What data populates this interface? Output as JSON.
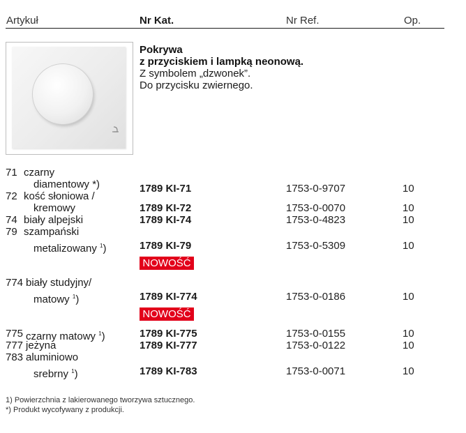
{
  "header": {
    "artykul": "Artykuł",
    "nr_kat": "Nr Kat.",
    "nr_ref": "Nr Ref.",
    "op": "Op."
  },
  "product": {
    "title_line1": "Pokrywa",
    "title_line2": "z przyciskiem i lampką neonową.",
    "desc_line1": "Z symbolem „dzwonek”.",
    "desc_line2": "Do przycisku zwiernego.",
    "image_icon": "bell-symbol-icon"
  },
  "rows": [
    {
      "num": "71",
      "name1": "czarny",
      "name2": "diamentowy *)",
      "sup": "",
      "kat": "1789 KI-71",
      "ref": "1753-0-9707",
      "op": "10"
    },
    {
      "num": "72",
      "name1": "kość słoniowa /",
      "name2": "kremowy",
      "sup": "",
      "kat": "1789 KI-72",
      "ref": "1753-0-0070",
      "op": "10"
    },
    {
      "num": "74",
      "name1": "biały alpejski",
      "name2": "",
      "sup": "",
      "kat": "1789 KI-74",
      "ref": "1753-0-4823",
      "op": "10"
    },
    {
      "num": "79",
      "name1": "szampański",
      "name2": "metalizowany",
      "sup": "1",
      "kat": "1789 KI-79",
      "ref": "1753-0-5309",
      "op": "10"
    },
    {
      "num": "774",
      "name1": "biały studyjny/",
      "name2": "matowy",
      "sup": "1",
      "kat": "1789 KI-774",
      "ref": "1753-0-0186",
      "op": "10"
    },
    {
      "num": "775",
      "name1": "czarny matowy",
      "name2": "",
      "sup": "1",
      "kat": "1789 KI-775",
      "ref": "1753-0-0155",
      "op": "10"
    },
    {
      "num": "777",
      "name1": "jeżyna",
      "name2": "",
      "sup": "",
      "kat": "1789 KI-777",
      "ref": "1753-0-0122",
      "op": "10"
    },
    {
      "num": "783",
      "name1": "aluminiowo",
      "name2": "srebrny",
      "sup": "1",
      "kat": "1789 KI-783",
      "ref": "1753-0-0071",
      "op": "10"
    }
  ],
  "badges": [
    "NOWOŚĆ",
    "NOWOŚĆ"
  ],
  "footnotes": {
    "f1": "1)  Powierzchnia z lakierowanego tworzywa sztucznego.",
    "f2": "*)  Produkt wycofywany z produkcji."
  },
  "colors": {
    "badge": "#e2001a",
    "text": "#1a1a1a"
  }
}
